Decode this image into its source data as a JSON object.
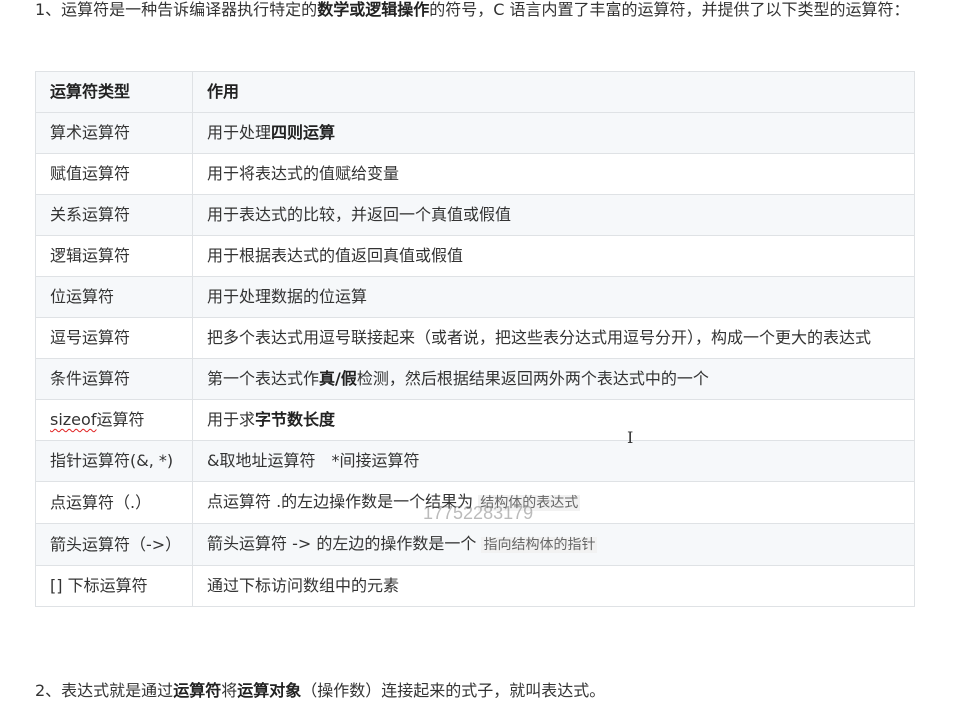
{
  "intro": {
    "prefix": "1、运算符是一种告诉编译器执行特定的",
    "bold": "数学或逻辑操作",
    "suffix": "的符号，C 语言内置了丰富的运算符，并提供了以下类型的运算符："
  },
  "table": {
    "headers": [
      "运算符类型",
      "作用"
    ],
    "rows": {
      "arith": {
        "type": "算术运算符",
        "desc_pre": "用于处理",
        "desc_bold": "四则运算"
      },
      "assign": {
        "type": "赋值运算符",
        "desc": "用于将表达式的值赋给变量"
      },
      "relation": {
        "type": "关系运算符",
        "desc": "用于表达式的比较，并返回一个真值或假值"
      },
      "logic": {
        "type": "逻辑运算符",
        "desc": "用于根据表达式的值返回真值或假值"
      },
      "bit": {
        "type": "位运算符",
        "desc": "用于处理数据的位运算"
      },
      "comma": {
        "type": "逗号运算符",
        "desc": "把多个表达式用逗号联接起来（或者说，把这些表分达式用逗号分开），构成一个更大的表达式"
      },
      "cond": {
        "type": "条件运算符",
        "desc_pre": "第一个表达式作",
        "desc_bold": "真/假",
        "desc_post": "检测，然后根据结果返回两外两个表达式中的一个"
      },
      "sizeof": {
        "type_pre": "sizeof",
        "type_post": "运算符",
        "desc_pre": "用于求",
        "desc_bold": "字节数长度"
      },
      "pointer": {
        "type": "指针运算符(&, *)",
        "desc": "&取地址运算符　*间接运算符"
      },
      "dot": {
        "type": "点运算符（.）",
        "desc_pre": "点运算符 .的左边操作数是一个结果为 ",
        "desc_hl": "结构体的表达式"
      },
      "arrow": {
        "type": "箭头运算符（->）",
        "desc_pre": "箭头运算符 -> 的左边的操作数是一个 ",
        "desc_hl": "指向结构体的指针"
      },
      "subscript": {
        "type": "[] 下标运算符",
        "desc": "通过下标访问数组中的元素"
      }
    }
  },
  "outro": {
    "p1": "2、表达式就是通过",
    "b1": "运算符",
    "p2": "将",
    "b2": "运算对象",
    "p3": "（操作数）连接起来的式子，就叫表达式。"
  },
  "watermark": "17752283179",
  "cursor_glyph": "I"
}
